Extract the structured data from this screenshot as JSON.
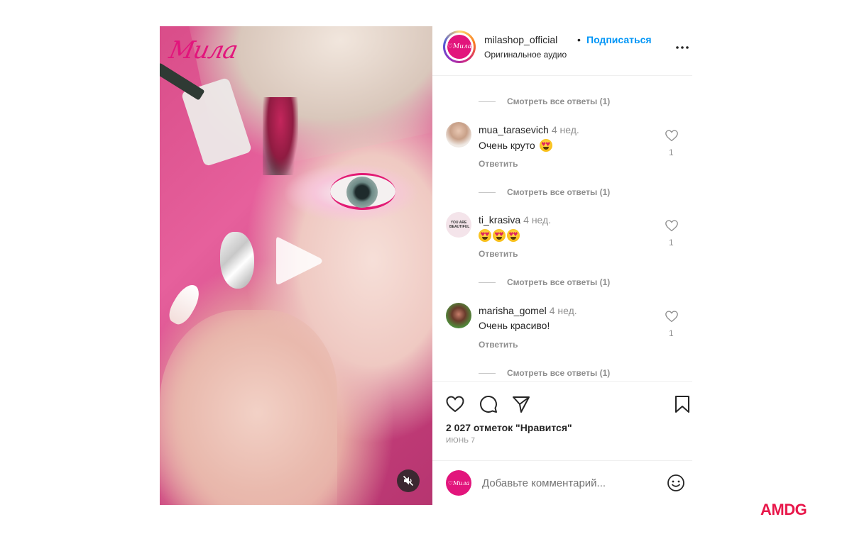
{
  "media": {
    "brand_logo": "Мила",
    "play_icon": "play-icon",
    "mute_icon": "speaker-muted-icon"
  },
  "header": {
    "username": "milashop_official",
    "separator": "•",
    "follow_label": "Подписаться",
    "audio_label": "Оригинальное аудио",
    "more_icon": "more-horizontal-icon"
  },
  "comments": {
    "view_replies_label": "Смотреть все ответы (1)",
    "reply_label": "Ответить",
    "items": [
      {
        "username": "mua_tarasevich",
        "time": "4 нед.",
        "text": "Очень круто",
        "emoji_count": 1,
        "likes": "1"
      },
      {
        "username": "ti_krasiva",
        "time": "4 нед.",
        "text": "",
        "emoji_count": 3,
        "likes": "1",
        "avatar_text": "YOU ARE BEAUTIFUL"
      },
      {
        "username": "marisha_gomel",
        "time": "4 нед.",
        "text": "Очень красиво!",
        "emoji_count": 0,
        "likes": "1"
      }
    ]
  },
  "actions": {
    "like_icon": "heart-icon",
    "comment_icon": "comment-bubble-icon",
    "share_icon": "paper-plane-icon",
    "save_icon": "bookmark-icon",
    "likes_count": "2 027 отметок \"Нравится\"",
    "date": "ИЮНЬ 7"
  },
  "add_comment": {
    "placeholder": "Добавьте комментарий...",
    "emoji_icon": "smiley-icon"
  },
  "agency_logo": "AMDG",
  "colors": {
    "brand": "#e2157c",
    "link": "#0095f6",
    "muted": "#8e8e8e",
    "agency": "#e8174a"
  }
}
